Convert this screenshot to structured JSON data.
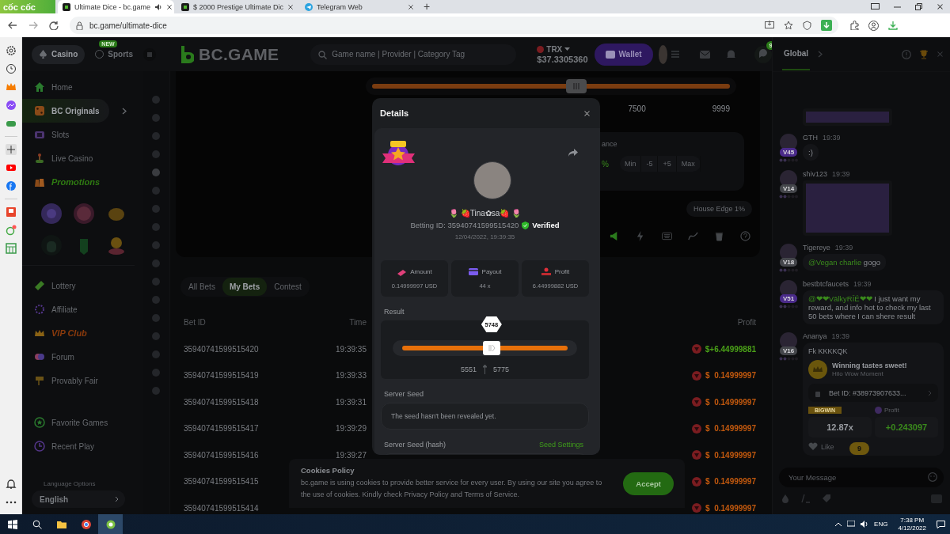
{
  "browser": {
    "brand": "cốc cốc",
    "tabs": [
      {
        "title": "Ultimate Dice - bc.game",
        "selected": true
      },
      {
        "title": "$ 2000 Prestige Ultimate Dic",
        "selected": false
      },
      {
        "title": "Telegram Web",
        "selected": false
      }
    ],
    "new_tab": "+",
    "url": "bc.game/ultimate-dice"
  },
  "header": {
    "nav_tabs": [
      {
        "label": "Casino",
        "selected": true
      },
      {
        "label": "Sports",
        "selected": false,
        "badge": "NEW"
      }
    ],
    "logo": "BC.GAME",
    "search_placeholder": "Game name | Provider | Category Tag",
    "currency": "TRX",
    "balance": "$37.3305360",
    "wallet": "Wallet",
    "chat_badge": "9"
  },
  "nav": {
    "primary": [
      {
        "label": "Home",
        "selected": false,
        "kind": "plain"
      },
      {
        "label": "BC Originals",
        "selected": true,
        "kind": "plain"
      },
      {
        "label": "Slots",
        "selected": false,
        "kind": "plain"
      },
      {
        "label": "Live Casino",
        "selected": false,
        "kind": "plain"
      },
      {
        "label": "Promotions",
        "selected": false,
        "kind": "featured",
        "color": "#2f7a12"
      }
    ],
    "secondary": [
      {
        "label": "Lottery",
        "selected": false,
        "kind": "plain"
      },
      {
        "label": "Affiliate",
        "selected": false,
        "kind": "plain"
      },
      {
        "label": "VIP Club",
        "selected": false,
        "kind": "featured",
        "color": "#8a3a0c"
      },
      {
        "label": "Forum",
        "selected": false,
        "kind": "plain"
      },
      {
        "label": "Provably Fair",
        "selected": false,
        "kind": "plain"
      }
    ],
    "personal": [
      {
        "label": "Favorite Games",
        "selected": false,
        "kind": "plain"
      },
      {
        "label": "Recent Play",
        "selected": false,
        "kind": "plain"
      }
    ],
    "language_label": "Language Options",
    "language": "English"
  },
  "game": {
    "slider": {
      "level": 0.57
    },
    "scale": [
      "7500",
      "9999"
    ],
    "chance_label": "ance",
    "chance_unit": "%",
    "chance_buttons": [
      "Min",
      "-5",
      "+5",
      "Max"
    ],
    "house_edge": "House Edge 1%"
  },
  "bets": {
    "tabs": [
      {
        "label": "All Bets",
        "selected": false
      },
      {
        "label": "My Bets",
        "selected": true
      },
      {
        "label": "Contest",
        "selected": false
      }
    ],
    "columns": [
      "Bet ID",
      "Time",
      "Profit"
    ],
    "rows": [
      {
        "bet_id": "35940741599515420",
        "time": "19:39:35",
        "profit": "$+6.44999881",
        "win": true
      },
      {
        "bet_id": "35940741599515419",
        "time": "19:39:33",
        "profit": "$  0.14999997",
        "win": false
      },
      {
        "bet_id": "35940741599515418",
        "time": "19:39:31",
        "profit": "$  0.14999997",
        "win": false
      },
      {
        "bet_id": "35940741599515417",
        "time": "19:39:29",
        "profit": "$  0.14999997",
        "win": false
      },
      {
        "bet_id": "35940741599515416",
        "time": "19:39:27",
        "profit": "$  0.14999997",
        "win": false
      },
      {
        "bet_id": "35940741599515415",
        "profit": "$  0.14999997",
        "win": false
      },
      {
        "bet_id": "35940741599515414",
        "profit": "$  0.14999997",
        "win": false
      }
    ]
  },
  "chat": {
    "title": "Global",
    "messages": [
      {
        "kind": "image"
      },
      {
        "kind": "text",
        "user": "GTH",
        "time": "19:39",
        "vip": "V45",
        "color": "#4a2a8a",
        "text": ":)"
      },
      {
        "kind": "image",
        "user": "shiv123",
        "time": "19:39",
        "vip": "V14",
        "color": "#44464b"
      },
      {
        "kind": "text",
        "user": "Tigereye",
        "time": "19:39",
        "vip": "V18",
        "color": "#44464b",
        "mention": "@Vegan charlie",
        "text": "gogo"
      },
      {
        "kind": "text",
        "user": "bestbtcfaucets",
        "time": "19:39",
        "vip": "V51",
        "color": "#4a2a8a",
        "mention": "@❤❤VālkyRĪÉ❤❤",
        "text": "I just want my reward, and info hot to check my last 50 bets where I can shere result"
      },
      {
        "kind": "card",
        "user": "Ananya",
        "time": "19:39",
        "vip": "V16",
        "color": "#44464b",
        "text": "Fk KKKKQK",
        "card": {
          "title": "Winning tastes sweet!",
          "subtitle": "Hilo Wow Moment",
          "bet": "Bet ID: #38973907633...",
          "tag": "BIGWIN",
          "profit_label": "Profit",
          "multiplier": "12.87x",
          "profit": "+0.243097"
        },
        "like": "Like"
      }
    ],
    "unread": "9",
    "input_placeholder": "Your Message"
  },
  "modal": {
    "title": "Details",
    "user": "🌷 🍓Tina✿sa🍓 🌷",
    "betting_id": "Betting ID: 35940741599515420",
    "verified": "Verified",
    "date": "12/04/2022, 19:39:35",
    "stats": [
      {
        "label": "Amount",
        "value": "0.14999997 USD"
      },
      {
        "label": "Payout",
        "value": "44 x"
      },
      {
        "label": "Profit",
        "value": "6.44999882 USD"
      }
    ],
    "result_label": "Result",
    "result": {
      "value": "5748",
      "level": 0.54,
      "range": [
        "5551",
        "5775"
      ]
    },
    "server_seed_label": "Server Seed",
    "server_seed": "The seed hasn't been revealed yet.",
    "hash_label": "Server Seed (hash)",
    "seed_settings": "Seed Settings"
  },
  "cookie": {
    "title": "Cookies Policy",
    "text": "bc.game is using cookies to provide better service for every user. By using our site you agree to the use of cookies. Kindly check Privacy Policy and Terms of Service.",
    "button": "Accept"
  },
  "taskbar": {
    "lang": "ENG",
    "time": "7:38 PM",
    "date": "4/12/2022"
  }
}
